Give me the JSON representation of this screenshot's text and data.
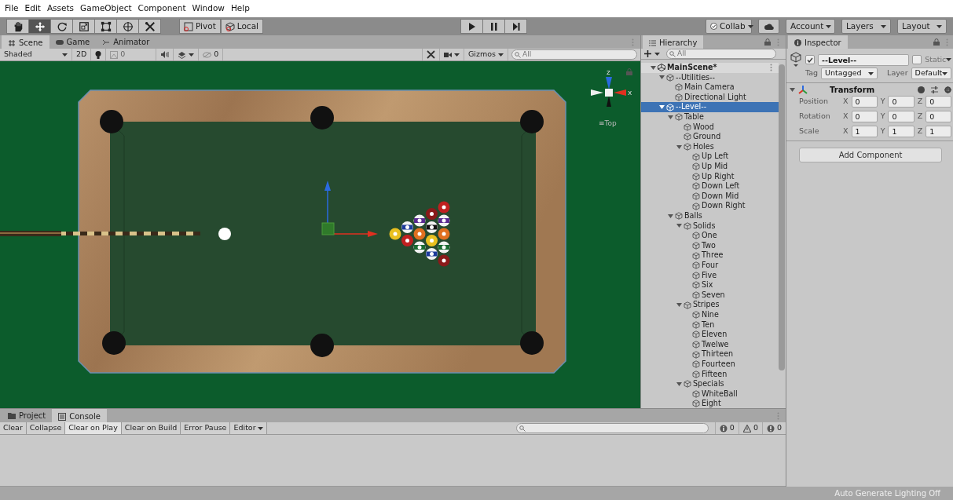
{
  "menu": [
    "File",
    "Edit",
    "Assets",
    "GameObject",
    "Component",
    "Window",
    "Help"
  ],
  "toolbar": {
    "tools": [
      {
        "kind": "hand",
        "selected": false
      },
      {
        "kind": "move",
        "selected": true
      },
      {
        "kind": "rotate",
        "selected": false
      },
      {
        "kind": "scale",
        "selected": false
      },
      {
        "kind": "rect",
        "selected": false
      },
      {
        "kind": "transform",
        "selected": false
      },
      {
        "kind": "custom",
        "selected": false
      }
    ],
    "pivot": "Pivot",
    "local": "Local",
    "collab": "Collab",
    "account": "Account",
    "layers": "Layers",
    "layout": "Layout"
  },
  "scene_tabs": [
    {
      "label": "Scene",
      "kind": "scene",
      "selected": true
    },
    {
      "label": "Game",
      "kind": "game",
      "selected": false
    },
    {
      "label": "Animator",
      "kind": "animator",
      "selected": false
    }
  ],
  "scene_toolbar": {
    "shading": "Shaded",
    "mode_2d": "2D",
    "fx_count": "0",
    "hidden_count": "0",
    "gizmos": "Gizmos",
    "search_placeholder": "All"
  },
  "scene": {
    "axis_labels": [
      "z",
      "x"
    ],
    "view": "≡Top"
  },
  "hierarchy": {
    "title": "Hierarchy",
    "search_placeholder": "All",
    "items": [
      {
        "label": "MainScene*",
        "kind": "scene",
        "expanded": true,
        "selected": false,
        "children": [
          {
            "label": "--Utilities--",
            "kind": "object",
            "expanded": true,
            "selected": false,
            "children": [
              {
                "label": "Main Camera",
                "kind": "object",
                "selected": false
              },
              {
                "label": "Directional Light",
                "kind": "object",
                "selected": false
              }
            ]
          },
          {
            "label": "--Level--",
            "kind": "object",
            "expanded": true,
            "selected": true,
            "children": [
              {
                "label": "Table",
                "kind": "object",
                "expanded": true,
                "selected": false,
                "children": [
                  {
                    "label": "Wood",
                    "kind": "object",
                    "selected": false
                  },
                  {
                    "label": "Ground",
                    "kind": "object",
                    "selected": false
                  },
                  {
                    "label": "Holes",
                    "kind": "object",
                    "expanded": true,
                    "selected": false,
                    "children": [
                      {
                        "label": "Up Left",
                        "kind": "object",
                        "selected": false
                      },
                      {
                        "label": "Up Mid",
                        "kind": "object",
                        "selected": false
                      },
                      {
                        "label": "Up Right",
                        "kind": "object",
                        "selected": false
                      },
                      {
                        "label": "Down Left",
                        "kind": "object",
                        "selected": false
                      },
                      {
                        "label": "Down Mid",
                        "kind": "object",
                        "selected": false
                      },
                      {
                        "label": "Down Right",
                        "kind": "object",
                        "selected": false
                      }
                    ]
                  }
                ]
              },
              {
                "label": "Balls",
                "kind": "object",
                "expanded": true,
                "selected": false,
                "children": [
                  {
                    "label": "Solids",
                    "kind": "object",
                    "expanded": true,
                    "selected": false,
                    "children": [
                      {
                        "label": "One",
                        "kind": "object",
                        "selected": false
                      },
                      {
                        "label": "Two",
                        "kind": "object",
                        "selected": false
                      },
                      {
                        "label": "Three",
                        "kind": "object",
                        "selected": false
                      },
                      {
                        "label": "Four",
                        "kind": "object",
                        "selected": false
                      },
                      {
                        "label": "Five",
                        "kind": "object",
                        "selected": false
                      },
                      {
                        "label": "Six",
                        "kind": "object",
                        "selected": false
                      },
                      {
                        "label": "Seven",
                        "kind": "object",
                        "selected": false
                      }
                    ]
                  },
                  {
                    "label": "Stripes",
                    "kind": "object",
                    "expanded": true,
                    "selected": false,
                    "children": [
                      {
                        "label": "Nine",
                        "kind": "object",
                        "selected": false
                      },
                      {
                        "label": "Ten",
                        "kind": "object",
                        "selected": false
                      },
                      {
                        "label": "Eleven",
                        "kind": "object",
                        "selected": false
                      },
                      {
                        "label": "Twelwe",
                        "kind": "object",
                        "selected": false
                      },
                      {
                        "label": "Thirteen",
                        "kind": "object",
                        "selected": false
                      },
                      {
                        "label": "Fourteen",
                        "kind": "object",
                        "selected": false
                      },
                      {
                        "label": "Fifteen",
                        "kind": "object",
                        "selected": false
                      }
                    ]
                  },
                  {
                    "label": "Specials",
                    "kind": "object",
                    "expanded": true,
                    "selected": false,
                    "children": [
                      {
                        "label": "WhiteBall",
                        "kind": "object",
                        "selected": false
                      },
                      {
                        "label": "Eight",
                        "kind": "object",
                        "selected": false
                      }
                    ]
                  }
                ]
              }
            ]
          }
        ]
      }
    ]
  },
  "inspector": {
    "title": "Inspector",
    "object": {
      "name": "--Level--",
      "active": true,
      "static": false,
      "static_label": "Static",
      "tag_label": "Tag",
      "tag": "Untagged",
      "layer_label": "Layer",
      "layer": "Default"
    },
    "components": [
      {
        "title": "Transform",
        "expanded": true,
        "rows": [
          {
            "label": "Position",
            "fields": [
              {
                "axis": "X",
                "value": "0"
              },
              {
                "axis": "Y",
                "value": "0"
              },
              {
                "axis": "Z",
                "value": "0"
              }
            ]
          },
          {
            "label": "Rotation",
            "fields": [
              {
                "axis": "X",
                "value": "0"
              },
              {
                "axis": "Y",
                "value": "0"
              },
              {
                "axis": "Z",
                "value": "0"
              }
            ]
          },
          {
            "label": "Scale",
            "fields": [
              {
                "axis": "X",
                "value": "1"
              },
              {
                "axis": "Y",
                "value": "1"
              },
              {
                "axis": "Z",
                "value": "1"
              }
            ]
          }
        ]
      }
    ],
    "add_button": "Add Component"
  },
  "console": {
    "tabs": [
      {
        "label": "Project",
        "kind": "project",
        "selected": false
      },
      {
        "label": "Console",
        "kind": "console",
        "selected": true
      }
    ],
    "buttons": [
      {
        "label": "Clear",
        "kind": "button",
        "on": false
      },
      {
        "label": "Collapse",
        "kind": "toggle",
        "on": false
      },
      {
        "label": "Clear on Play",
        "kind": "toggle",
        "on": true
      },
      {
        "label": "Clear on Build",
        "kind": "toggle",
        "on": false
      },
      {
        "label": "Error Pause",
        "kind": "toggle",
        "on": false
      },
      {
        "label": "Editor",
        "kind": "dropdown",
        "on": false
      }
    ],
    "counts": [
      {
        "kind": "info",
        "count": "0"
      },
      {
        "kind": "warning",
        "count": "0"
      },
      {
        "kind": "error",
        "count": "0"
      }
    ]
  },
  "status_bar": "Auto Generate Lighting Off"
}
